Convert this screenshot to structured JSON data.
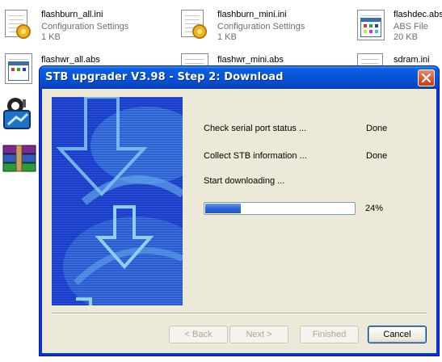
{
  "files": [
    {
      "name": "flashburn_all.ini",
      "type": "Configuration Settings",
      "size": "1 KB",
      "icon": "config-settings-icon"
    },
    {
      "name": "flashburn_mini.ini",
      "type": "Configuration Settings",
      "size": "1 KB",
      "icon": "config-settings-icon"
    },
    {
      "name": "flashdec.abs",
      "type": "ABS File",
      "size": "20 KB",
      "icon": "abs-file-icon"
    },
    {
      "name": "flashwr_all.abs",
      "icon": "abs-file-icon"
    },
    {
      "name": "flashwr_mini.abs",
      "icon": "abs-file-icon"
    },
    {
      "name": "sdram.ini",
      "icon": "config-settings-icon"
    }
  ],
  "dialog": {
    "title": "STB upgrader V3.98 - Step 2: Download",
    "steps": [
      {
        "label": "Check serial port status ...",
        "status": "Done"
      },
      {
        "label": "Collect STB information ...",
        "status": "Done"
      },
      {
        "label": "Start downloading ...",
        "status": ""
      }
    ],
    "progress": {
      "value": 0.24,
      "label": "24%"
    },
    "buttons": {
      "back": "< Back",
      "next": "Next >",
      "finished": "Finished",
      "cancel": "Cancel"
    }
  },
  "colors": {
    "titlebar": "#0753d7",
    "dialog_bg": "#ece9d8",
    "progress_fill": "#2c63d6",
    "banner_bg": "#1d3fc7"
  }
}
